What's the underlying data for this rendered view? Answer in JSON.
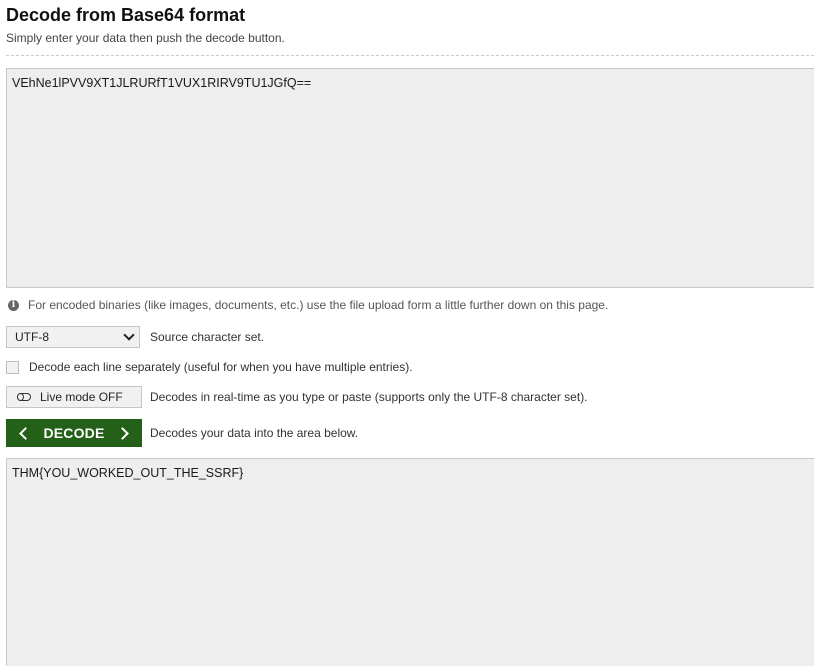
{
  "header": {
    "title": "Decode from Base64 format",
    "subtitle": "Simply enter your data then push the decode button."
  },
  "input": {
    "value": "VEhNe1lPVV9XT1JLRURfT1VUX1RIRV9TU1JGfQ=="
  },
  "info": {
    "icon": "info-icon",
    "text": "For encoded binaries (like images, documents, etc.) use the file upload form a little further down on this page."
  },
  "charset": {
    "selected": "UTF-8",
    "label": "Source character set."
  },
  "decode_each_line": {
    "checked": false,
    "label": "Decode each line separately (useful for when you have multiple entries)."
  },
  "live_mode": {
    "button_label": "Live mode OFF",
    "description": "Decodes in real-time as you type or paste (supports only the UTF-8 character set)."
  },
  "decode": {
    "button_label": "DECODE",
    "description": "Decodes your data into the area below.",
    "color": "#246018"
  },
  "output": {
    "value": "THM{YOU_WORKED_OUT_THE_SSRF}"
  }
}
